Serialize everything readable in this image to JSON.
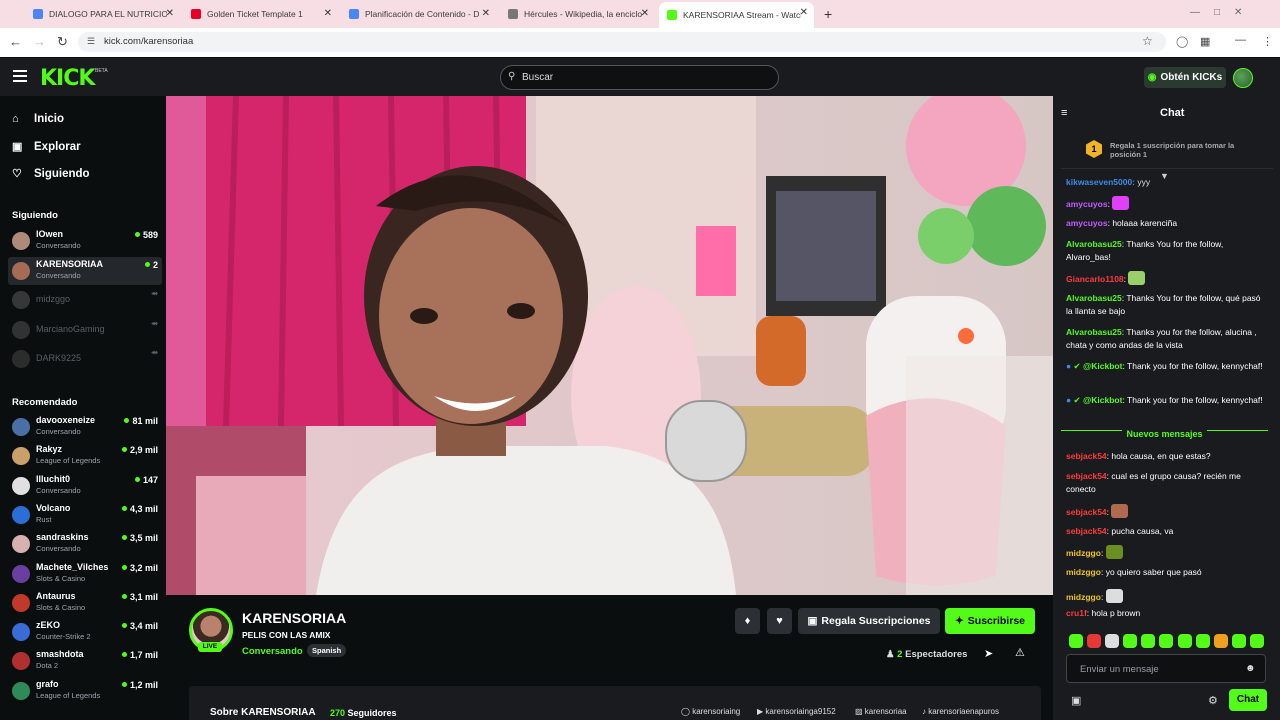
{
  "browser": {
    "tabs": [
      {
        "title": "DIALOGO PARA EL NUTRICION",
        "color": "#4a86f5"
      },
      {
        "title": "Golden Ticket Template 1",
        "color": "#e60023"
      },
      {
        "title": "Planificación de Contenido - D",
        "color": "#4a86f5"
      },
      {
        "title": "Hércules - Wikipedia, la enciclo",
        "color": "#777777"
      },
      {
        "title": "KARENSORIAA Stream - Watch",
        "color": "#53fc18"
      }
    ],
    "tab_close": "✕",
    "new_tab": "+",
    "url": "kick.com/karensoriaa"
  },
  "header": {
    "logo": "KICK",
    "logo_badge": "BETA",
    "search_placeholder": "Buscar",
    "kicks_button": "Obtén KICKs"
  },
  "sidebar": {
    "nav": [
      {
        "label": "Inicio",
        "icon": "⌂"
      },
      {
        "label": "Explorar",
        "icon": "▣"
      },
      {
        "label": "Siguiendo",
        "icon": "♡"
      }
    ],
    "following_title": "Siguiendo",
    "following": [
      {
        "name": "lOwen",
        "category": "Conversando",
        "viewers": "589",
        "color": "#b08a78",
        "online": true,
        "selected": false
      },
      {
        "name": "KARENSORIAA",
        "category": "Conversando",
        "viewers": "2",
        "color": "#a56b55",
        "online": true,
        "selected": true
      },
      {
        "name": "midzggo",
        "category": "",
        "viewers": "",
        "color": "#888888",
        "online": false,
        "selected": false
      },
      {
        "name": "MarcianoGaming",
        "category": "",
        "viewers": "",
        "color": "#777777",
        "online": false,
        "selected": false
      },
      {
        "name": "DARK9225",
        "category": "",
        "viewers": "",
        "color": "#666666",
        "online": false,
        "selected": false
      }
    ],
    "offline_glyph": "⇴",
    "recommended_title": "Recomendado",
    "recommended": [
      {
        "name": "davooxeneize",
        "category": "Conversando",
        "viewers": "81 mil",
        "color": "#4a6fa5"
      },
      {
        "name": "Rakyz",
        "category": "League of Legends",
        "viewers": "2,9 mil",
        "color": "#c9a06b"
      },
      {
        "name": "Illuchit0",
        "category": "Conversando",
        "viewers": "147",
        "color": "#e0e0e0"
      },
      {
        "name": "Volcano",
        "category": "Rust",
        "viewers": "4,3 mil",
        "color": "#2b6fd6"
      },
      {
        "name": "sandraskins",
        "category": "Conversando",
        "viewers": "3,5 mil",
        "color": "#d8b0b0"
      },
      {
        "name": "Machete_Vilches",
        "category": "Slots & Casino",
        "viewers": "3,2 mil",
        "color": "#6b3fa0"
      },
      {
        "name": "Antaurus",
        "category": "Slots & Casino",
        "viewers": "3,1 mil",
        "color": "#c0392b"
      },
      {
        "name": "zEKO",
        "category": "Counter-Strike 2",
        "viewers": "3,4 mil",
        "color": "#3a6bd6"
      },
      {
        "name": "smashdota",
        "category": "Dota 2",
        "viewers": "1,7 mil",
        "color": "#b03030"
      },
      {
        "name": "grafo",
        "category": "League of Legends",
        "viewers": "1,2 mil",
        "color": "#2e8b57"
      }
    ]
  },
  "stream": {
    "name": "KARENSORIAA",
    "title": "PELIS CON LAS AMIX",
    "category": "Conversando",
    "language": "Spanish",
    "live_label": "LIVE",
    "gift_label": "Regala Suscripciones",
    "subscribe_label": "Suscribirse",
    "viewers_count": "2",
    "viewers_label": "Espectadores",
    "about_label": "Sobre KARENSORIAA",
    "followers_count": "270",
    "followers_label": "Seguidores",
    "socials": [
      "karensoriaing",
      "karensoriainga9152",
      "karensoriaa",
      "karensoriaenapuros"
    ]
  },
  "chat": {
    "title": "Chat",
    "pinned_rank": "1",
    "pinned_text": "Regala 1 suscripción para tomar la posición 1",
    "scroll_glyph": "▼",
    "top_partial": "yyy",
    "messages": [
      {
        "user": "amycuyos",
        "color": "#c55cff",
        "text": "",
        "emote": "#e040fb"
      },
      {
        "user": "amycuyos",
        "color": "#c55cff",
        "text": "holaaa karenciña",
        "emote": ""
      },
      {
        "user": "Alvarobasu25",
        "color": "#53fc18",
        "text": "Thanks You for the follow, Alvaro_bas!",
        "emote": ""
      },
      {
        "user": "Giancarlo1108",
        "color": "#ff3b3b",
        "text": "",
        "emote": "#9ad06a"
      },
      {
        "user": "Alvarobasu25",
        "color": "#53fc18",
        "text": "Thanks You for the follow, qué pasó la llanta se bajo",
        "emote": ""
      },
      {
        "user": "Alvarobasu25",
        "color": "#53fc18",
        "text": "Thanks you for the follow, alucina , chata y como andas de la vista",
        "emote": ""
      },
      {
        "user": "@Kickbot",
        "color": "#53fc18",
        "text": "Thank you for the follow, kennychaf!",
        "emote": "",
        "bot": true
      },
      {
        "user": "@Kickbot",
        "color": "#53fc18",
        "text": "Thank you for the follow, kennychaf!",
        "emote": "",
        "bot": true
      }
    ],
    "new_messages_label": "Nuevos mensajes",
    "new_messages": [
      {
        "user": "sebjack54",
        "color": "#ff3b3b",
        "text": "hola causa, en que estas?",
        "emote": ""
      },
      {
        "user": "sebjack54",
        "color": "#ff3b3b",
        "text": "cual es el grupo causa? recién me conecto",
        "emote": ""
      },
      {
        "user": "sebjack54",
        "color": "#ff3b3b",
        "text": "",
        "emote": "#b06a50"
      },
      {
        "user": "sebjack54",
        "color": "#ff3b3b",
        "text": "pucha causa, va",
        "emote": ""
      },
      {
        "user": "midzggo",
        "color": "#f0c419",
        "text": "",
        "emote": "#6b8e23"
      },
      {
        "user": "midzggo",
        "color": "#f0c419",
        "text": "yo quiero saber que pasó",
        "emote": ""
      },
      {
        "user": "midzggo",
        "color": "#f0c419",
        "text": "",
        "emote": "#dddddd"
      },
      {
        "user": "cru1f",
        "color": "#ff3b3b",
        "text": "hola p brown",
        "emote": ""
      }
    ],
    "emote_bar": [
      "#53fc18",
      "#e53935",
      "#dddddd",
      "#53fc18",
      "#53fc18",
      "#53fc18",
      "#53fc18",
      "#53fc18",
      "#f0a020",
      "#53fc18",
      "#53fc18"
    ],
    "input_placeholder": "Enviar un mensaje",
    "send_label": "Chat"
  },
  "colors": {
    "accent": "#53fc18",
    "background": "#0b0e0f",
    "panel": "#191b1f"
  }
}
